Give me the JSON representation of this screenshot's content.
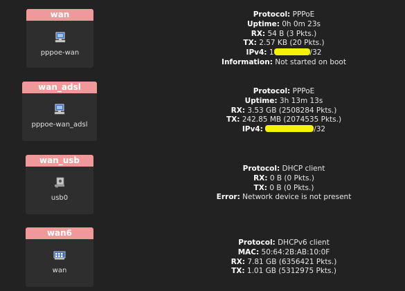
{
  "interfaces": [
    {
      "name": "wan",
      "device": "pppoe-wan",
      "icon": "network-ethernet-icon",
      "info": [
        {
          "label": "Protocol:",
          "value": "PPPoE"
        },
        {
          "label": "Uptime:",
          "value": "0h 0m 23s"
        },
        {
          "label": "RX:",
          "value": "54 B (3 Pkts.)"
        },
        {
          "label": "TX:",
          "value": "2.57 KB (20 Pkts.)"
        },
        {
          "label": "IPv4:",
          "value_prefix": "1",
          "value_suffix": "/32",
          "redacted": true
        },
        {
          "label": "Information:",
          "value": "Not started on boot"
        }
      ]
    },
    {
      "name": "wan_adsl",
      "device": "pppoe-wan_adsl",
      "icon": "network-ethernet-icon",
      "info": [
        {
          "label": "Protocol:",
          "value": "PPPoE"
        },
        {
          "label": "Uptime:",
          "value": "3h 13m 13s"
        },
        {
          "label": "RX:",
          "value": "3.53 GB (2508284 Pkts.)"
        },
        {
          "label": "TX:",
          "value": "242.85 MB (2074535 Pkts.)"
        },
        {
          "label": "IPv4:",
          "value_prefix": "",
          "value_suffix": "/32",
          "redacted": true
        }
      ]
    },
    {
      "name": "wan_usb",
      "device": "usb0",
      "icon": "usb-device-icon",
      "info": [
        {
          "label": "Protocol:",
          "value": "DHCP client"
        },
        {
          "label": "RX:",
          "value": "0 B (0 Pkts.)"
        },
        {
          "label": "TX:",
          "value": "0 B (0 Pkts.)"
        },
        {
          "label": "Error:",
          "value": "Network device is not present"
        }
      ]
    },
    {
      "name": "wan6",
      "device": "wan",
      "icon": "switch-port-icon",
      "info": [
        {
          "label": "Protocol:",
          "value": "DHCPv6 client"
        },
        {
          "label": "MAC:",
          "value": "50:64:2B:AB:10:0F"
        },
        {
          "label": "RX:",
          "value": "7.81 GB (6356421 Pkts.)"
        },
        {
          "label": "TX:",
          "value": "1.01 GB (5312975 Pkts.)"
        }
      ]
    }
  ],
  "colors": {
    "background": "#222222",
    "badge_bg": "#2e2e2e",
    "badge_title_bg": "#f0999a",
    "redaction": "#f5f20a"
  }
}
